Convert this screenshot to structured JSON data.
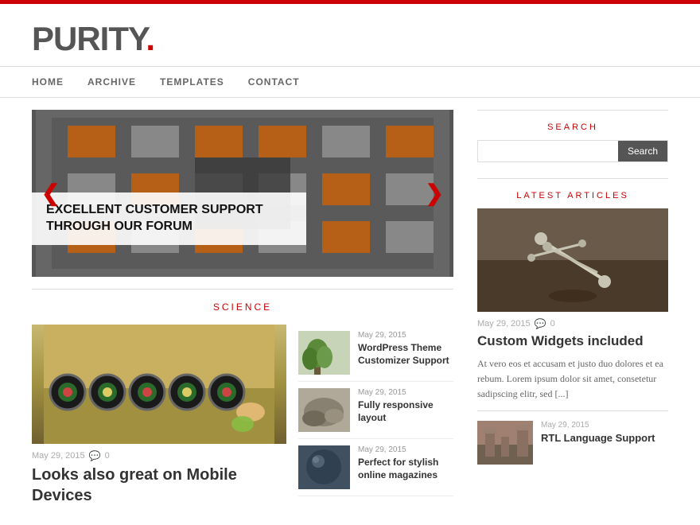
{
  "topBar": {
    "color": "#cc0000"
  },
  "header": {
    "logo": "PURITY",
    "logoDot": "."
  },
  "nav": {
    "items": [
      {
        "label": "HOME",
        "href": "#"
      },
      {
        "label": "ARCHIVE",
        "href": "#"
      },
      {
        "label": "TEMPLATES",
        "href": "#"
      },
      {
        "label": "CONTACT",
        "href": "#"
      }
    ]
  },
  "slider": {
    "caption": "EXCELLENT CUSTOMER SUPPORT THROUGH OUR FORUM",
    "arrowLeft": "❮",
    "arrowRight": "❯"
  },
  "science": {
    "sectionLabel": "SCIENCE",
    "mainArticle": {
      "date": "May 29, 2015",
      "commentCount": "0",
      "title": "Looks also great on Mobile Devices"
    },
    "sideArticles": [
      {
        "date": "May 29, 2015",
        "title": "WordPress Theme Customizer Support"
      },
      {
        "date": "May 29, 2015",
        "title": "Fully responsive layout"
      },
      {
        "date": "May 29, 2015",
        "title": "Perfect for stylish online magazines"
      }
    ]
  },
  "sidebar": {
    "searchTitle": "SEARCH",
    "searchPlaceholder": "",
    "searchButtonLabel": "Search",
    "latestTitle": "LATEST ARTICLES",
    "latestArticle": {
      "date": "May 29, 2015",
      "commentCount": "0",
      "title": "Custom Widgets included",
      "text": "At vero eos et accusam et justo duo dolores et ea rebum. Lorem ipsum dolor sit amet, consetetur sadipscing elitr, sed [...]"
    },
    "secondArticle": {
      "date": "May 29, 2015",
      "title": "RTL Language Support"
    }
  }
}
